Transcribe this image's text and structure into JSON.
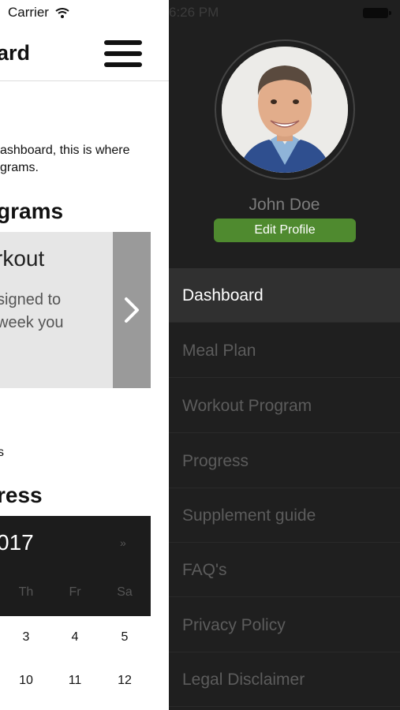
{
  "status_bar": {
    "carrier": "Carrier",
    "time": "6:26 PM"
  },
  "header": {
    "title": "ard"
  },
  "intro": {
    "line1": "ashboard, this is where",
    "line2": "grams."
  },
  "programs": {
    "section_title": "grams",
    "card": {
      "title": "rkout",
      "desc_line1": "signed to",
      "desc_line2": "week you"
    }
  },
  "fragment": "s",
  "progress": {
    "section_title": "ress"
  },
  "calendar": {
    "month_label": "017",
    "next": "»",
    "days_of_week": [
      "Th",
      "Fr",
      "Sa"
    ],
    "week1": [
      "3",
      "4",
      "5"
    ],
    "week2": [
      "10",
      "11",
      "12"
    ]
  },
  "profile": {
    "name": "John Doe",
    "edit_label": "Edit Profile"
  },
  "nav": {
    "items": [
      {
        "label": "Dashboard",
        "active": true
      },
      {
        "label": "Meal Plan"
      },
      {
        "label": "Workout Program"
      },
      {
        "label": "Progress"
      },
      {
        "label": "Supplement guide"
      },
      {
        "label": "FAQ's"
      },
      {
        "label": "Privacy Policy"
      },
      {
        "label": "Legal Disclaimer"
      }
    ]
  },
  "colors": {
    "accent_green": "#4f8a2f",
    "drawer_bg": "#1f1f1f",
    "active_item_bg": "#303030"
  }
}
